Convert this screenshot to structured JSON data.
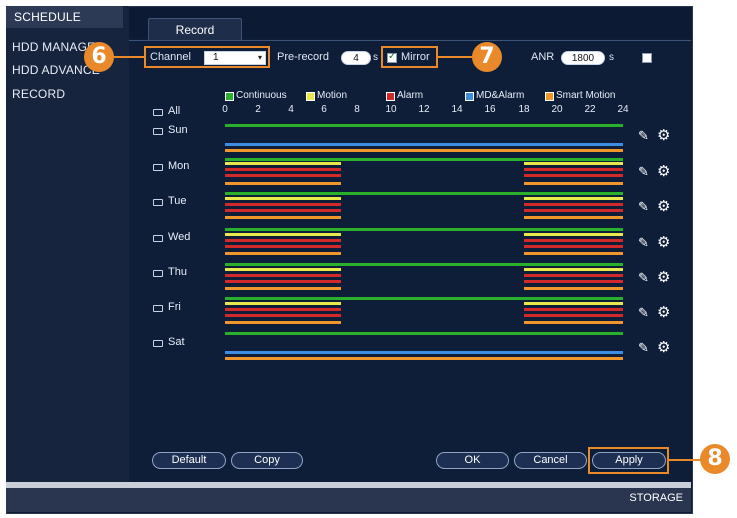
{
  "sidebar": {
    "items": [
      {
        "label": "SCHEDULE",
        "active": true
      },
      {
        "label": "HDD MANAGER"
      },
      {
        "label": "HDD ADVANCE"
      },
      {
        "label": "RECORD"
      }
    ]
  },
  "tab": {
    "label": "Record"
  },
  "controls": {
    "channel_label": "Channel",
    "channel_value": "1",
    "prerecord_label": "Pre-record",
    "prerecord_value": "4",
    "prerecord_unit": "s",
    "mirror_label": "Mirror",
    "mirror_checked": true,
    "anr_label": "ANR",
    "anr_value": "1800",
    "anr_unit": "s"
  },
  "callouts": {
    "c6": "6",
    "c7": "7",
    "c8": "8"
  },
  "legend": [
    {
      "label": "Continuous",
      "color": "#2bb02b"
    },
    {
      "label": "Motion",
      "color": "#e8e84a"
    },
    {
      "label": "Alarm",
      "color": "#d22a2a"
    },
    {
      "label": "MD&Alarm",
      "color": "#3d8ee0"
    },
    {
      "label": "Smart Motion",
      "color": "#f0962a"
    }
  ],
  "schedule": {
    "all_label": "All",
    "hours": [
      "0",
      "2",
      "4",
      "6",
      "8",
      "10",
      "12",
      "14",
      "16",
      "18",
      "20",
      "22",
      "24"
    ],
    "days": [
      {
        "label": "Sun"
      },
      {
        "label": "Mon"
      },
      {
        "label": "Tue"
      },
      {
        "label": "Wed"
      },
      {
        "label": "Thu"
      },
      {
        "label": "Fri"
      },
      {
        "label": "Sat"
      }
    ]
  },
  "buttons": {
    "default": "Default",
    "copy": "Copy",
    "ok": "OK",
    "cancel": "Cancel",
    "apply": "Apply"
  },
  "footer": {
    "label": "STORAGE"
  },
  "colors": {
    "accent": "#e9892a",
    "continuous": "#2bb02b",
    "motion": "#e8e84a",
    "alarm": "#d22a2a",
    "md_alarm": "#3d8ee0",
    "smart_motion": "#f0962a"
  }
}
